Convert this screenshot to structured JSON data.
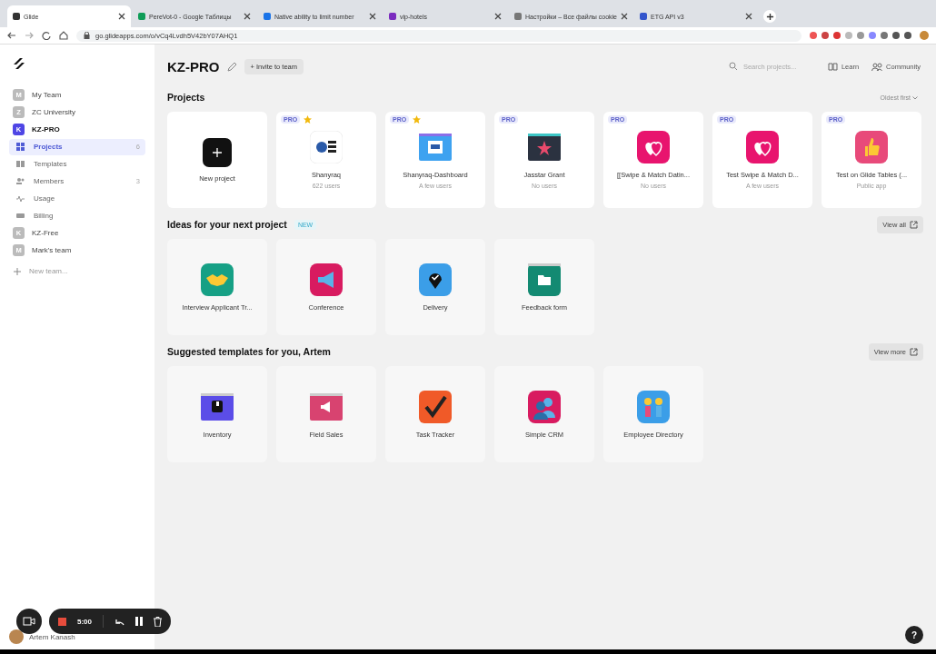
{
  "browser": {
    "tabs": [
      {
        "label": "Glide",
        "selected": true
      },
      {
        "label": "PereVot-0 - Google Таблицы",
        "selected": false
      },
      {
        "label": "Native ability to limit number",
        "selected": false
      },
      {
        "label": "vip-hotels",
        "selected": false
      },
      {
        "label": "Настройки – Все файлы cookie",
        "selected": false
      },
      {
        "label": "ETG API v3",
        "selected": false
      }
    ],
    "url": "go.glideapps.com/o/vCq4Lvdh5V42bY07AHQ1"
  },
  "sidebar": {
    "teams_before": [
      {
        "initial": "M",
        "name": "My Team"
      },
      {
        "initial": "Z",
        "name": "ZC University"
      }
    ],
    "current_team": {
      "initial": "K",
      "name": "KZ-PRO"
    },
    "nav": [
      {
        "label": "Projects",
        "count": "6",
        "selected": true
      },
      {
        "label": "Templates",
        "selected": false
      },
      {
        "label": "Members",
        "count": "3",
        "selected": false
      },
      {
        "label": "Usage",
        "selected": false
      },
      {
        "label": "Billing",
        "selected": false
      }
    ],
    "teams_after": [
      {
        "initial": "K",
        "name": "KZ-Free"
      },
      {
        "initial": "M",
        "name": "Mark's team"
      }
    ],
    "new_team": "New team...",
    "user": "Artem Kanash"
  },
  "header": {
    "title": "KZ-PRO",
    "invite": "+ Invite to team",
    "search_placeholder": "Search projects...",
    "learn": "Learn",
    "community": "Community"
  },
  "projects": {
    "title": "Projects",
    "sort": "Oldest first",
    "new_project": "New project",
    "items": [
      {
        "badge": "PRO",
        "starred": true,
        "name": "Shanyraq",
        "users": "622 users"
      },
      {
        "badge": "PRO",
        "starred": true,
        "name": "Shanyraq-Dashboard",
        "users": "A few users"
      },
      {
        "badge": "PRO",
        "starred": false,
        "name": "Jasstar Grant",
        "users": "No users"
      },
      {
        "badge": "PRO",
        "starred": false,
        "name": "[[Swipe & Match Datin...",
        "users": "No users"
      },
      {
        "badge": "PRO",
        "starred": false,
        "name": "Test Swipe & Match D...",
        "users": "A few users"
      },
      {
        "badge": "PRO",
        "starred": false,
        "name": "Test on Glide Tables (...",
        "users": "Public app"
      }
    ]
  },
  "ideas": {
    "title": "Ideas for your next project",
    "badge": "NEW",
    "button": "View all",
    "items": [
      "Interview Applicant Tr...",
      "Conference",
      "Delivery",
      "Feedback form"
    ]
  },
  "templates": {
    "title": "Suggested templates for you, Artem",
    "button": "View more",
    "items": [
      "Inventory",
      "Field Sales",
      "Task Tracker",
      "Simple CRM",
      "Employee Directory"
    ]
  },
  "recorder": {
    "time": "5:00"
  },
  "help": "?"
}
